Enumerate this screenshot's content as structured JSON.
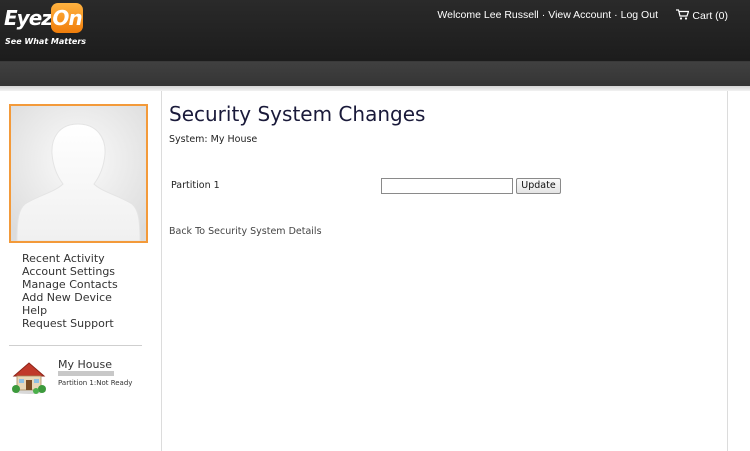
{
  "header": {
    "logo_word_1": "Eyez",
    "logo_word_2": "On",
    "logo_tagline": "See What Matters",
    "welcome_text": "Welcome Lee Russell",
    "separator": "·",
    "view_account_label": "View Account",
    "log_out_label": "Log Out",
    "cart_label": "Cart (0)"
  },
  "sidebar": {
    "avatar_icon": "person-silhouette-icon",
    "menu": [
      {
        "label": "Recent Activity"
      },
      {
        "label": "Account Settings"
      },
      {
        "label": "Manage Contacts"
      },
      {
        "label": "Add New Device"
      },
      {
        "label": "Help"
      },
      {
        "label": "Request Support"
      }
    ],
    "device": {
      "icon": "house-icon",
      "name": "My House",
      "status": "Partition 1:Not Ready"
    }
  },
  "main": {
    "title": "Security System Changes",
    "system_line": "System: My House",
    "partition_label": "Partition 1",
    "partition_value": "",
    "update_label": "Update",
    "back_link": "Back To Security System Details"
  },
  "colors": {
    "header_bg": "#1c1c1c",
    "accent_orange": "#f39a3a",
    "title_color": "#1a1a3a"
  }
}
